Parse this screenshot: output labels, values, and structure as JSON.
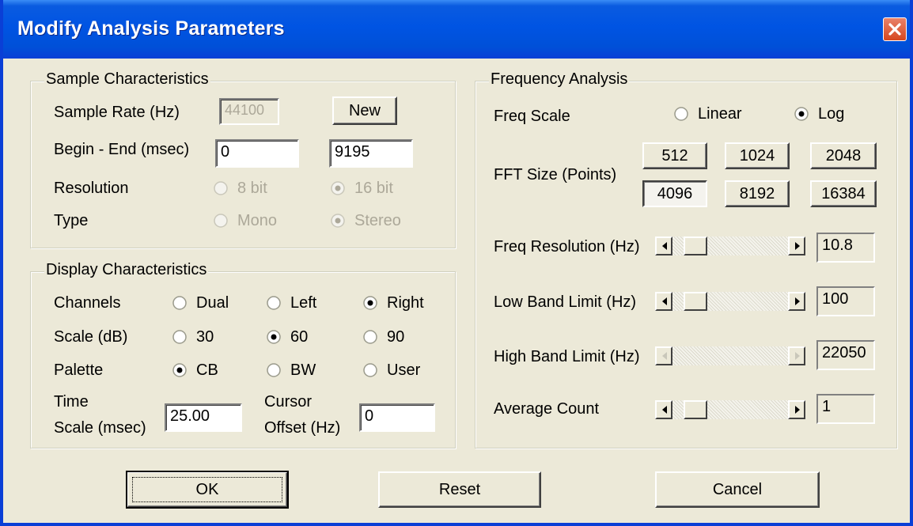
{
  "dialog": {
    "title": "Modify Analysis Parameters",
    "close_icon": "close-icon"
  },
  "sample": {
    "legend": "Sample Characteristics",
    "rate_label": "Sample Rate (Hz)",
    "rate_value": "44100",
    "new_button": "New",
    "begin_end_label": "Begin - End  (msec)",
    "begin_value": "0",
    "end_value": "9195",
    "resolution_label": "Resolution",
    "res_8": "8 bit",
    "res_16": "16 bit",
    "resolution_selected": "16 bit",
    "type_label": "Type",
    "type_mono": "Mono",
    "type_stereo": "Stereo",
    "type_selected": "Stereo"
  },
  "display": {
    "legend": "Display Characteristics",
    "channels_label": "Channels",
    "ch_dual": "Dual",
    "ch_left": "Left",
    "ch_right": "Right",
    "channels_selected": "Right",
    "scale_label": "Scale (dB)",
    "sc_30": "30",
    "sc_60": "60",
    "sc_90": "90",
    "scale_selected": "60",
    "palette_label": "Palette",
    "pal_cb": "CB",
    "pal_bw": "BW",
    "pal_user": "User",
    "palette_selected": "CB",
    "time_label_1": "Time",
    "time_label_2": "Scale (msec)",
    "time_value": "25.00",
    "cursor_label_1": "Cursor",
    "cursor_label_2": "Offset (Hz)",
    "cursor_value": "0"
  },
  "freq": {
    "legend": "Frequency Analysis",
    "scale_label": "Freq Scale",
    "linear": "Linear",
    "log": "Log",
    "scale_selected": "Log",
    "fft_label": "FFT Size (Points)",
    "fft_sizes": [
      "512",
      "1024",
      "2048",
      "4096",
      "8192",
      "16384"
    ],
    "fft_selected": "4096",
    "res_label": "Freq Resolution (Hz)",
    "res_value": "10.8",
    "low_label": "Low Band Limit (Hz)",
    "low_value": "100",
    "high_label": "High Band Limit (Hz)",
    "high_value": "22050",
    "avg_label": "Average Count",
    "avg_value": "1"
  },
  "buttons": {
    "ok": "OK",
    "reset": "Reset",
    "cancel": "Cancel"
  }
}
